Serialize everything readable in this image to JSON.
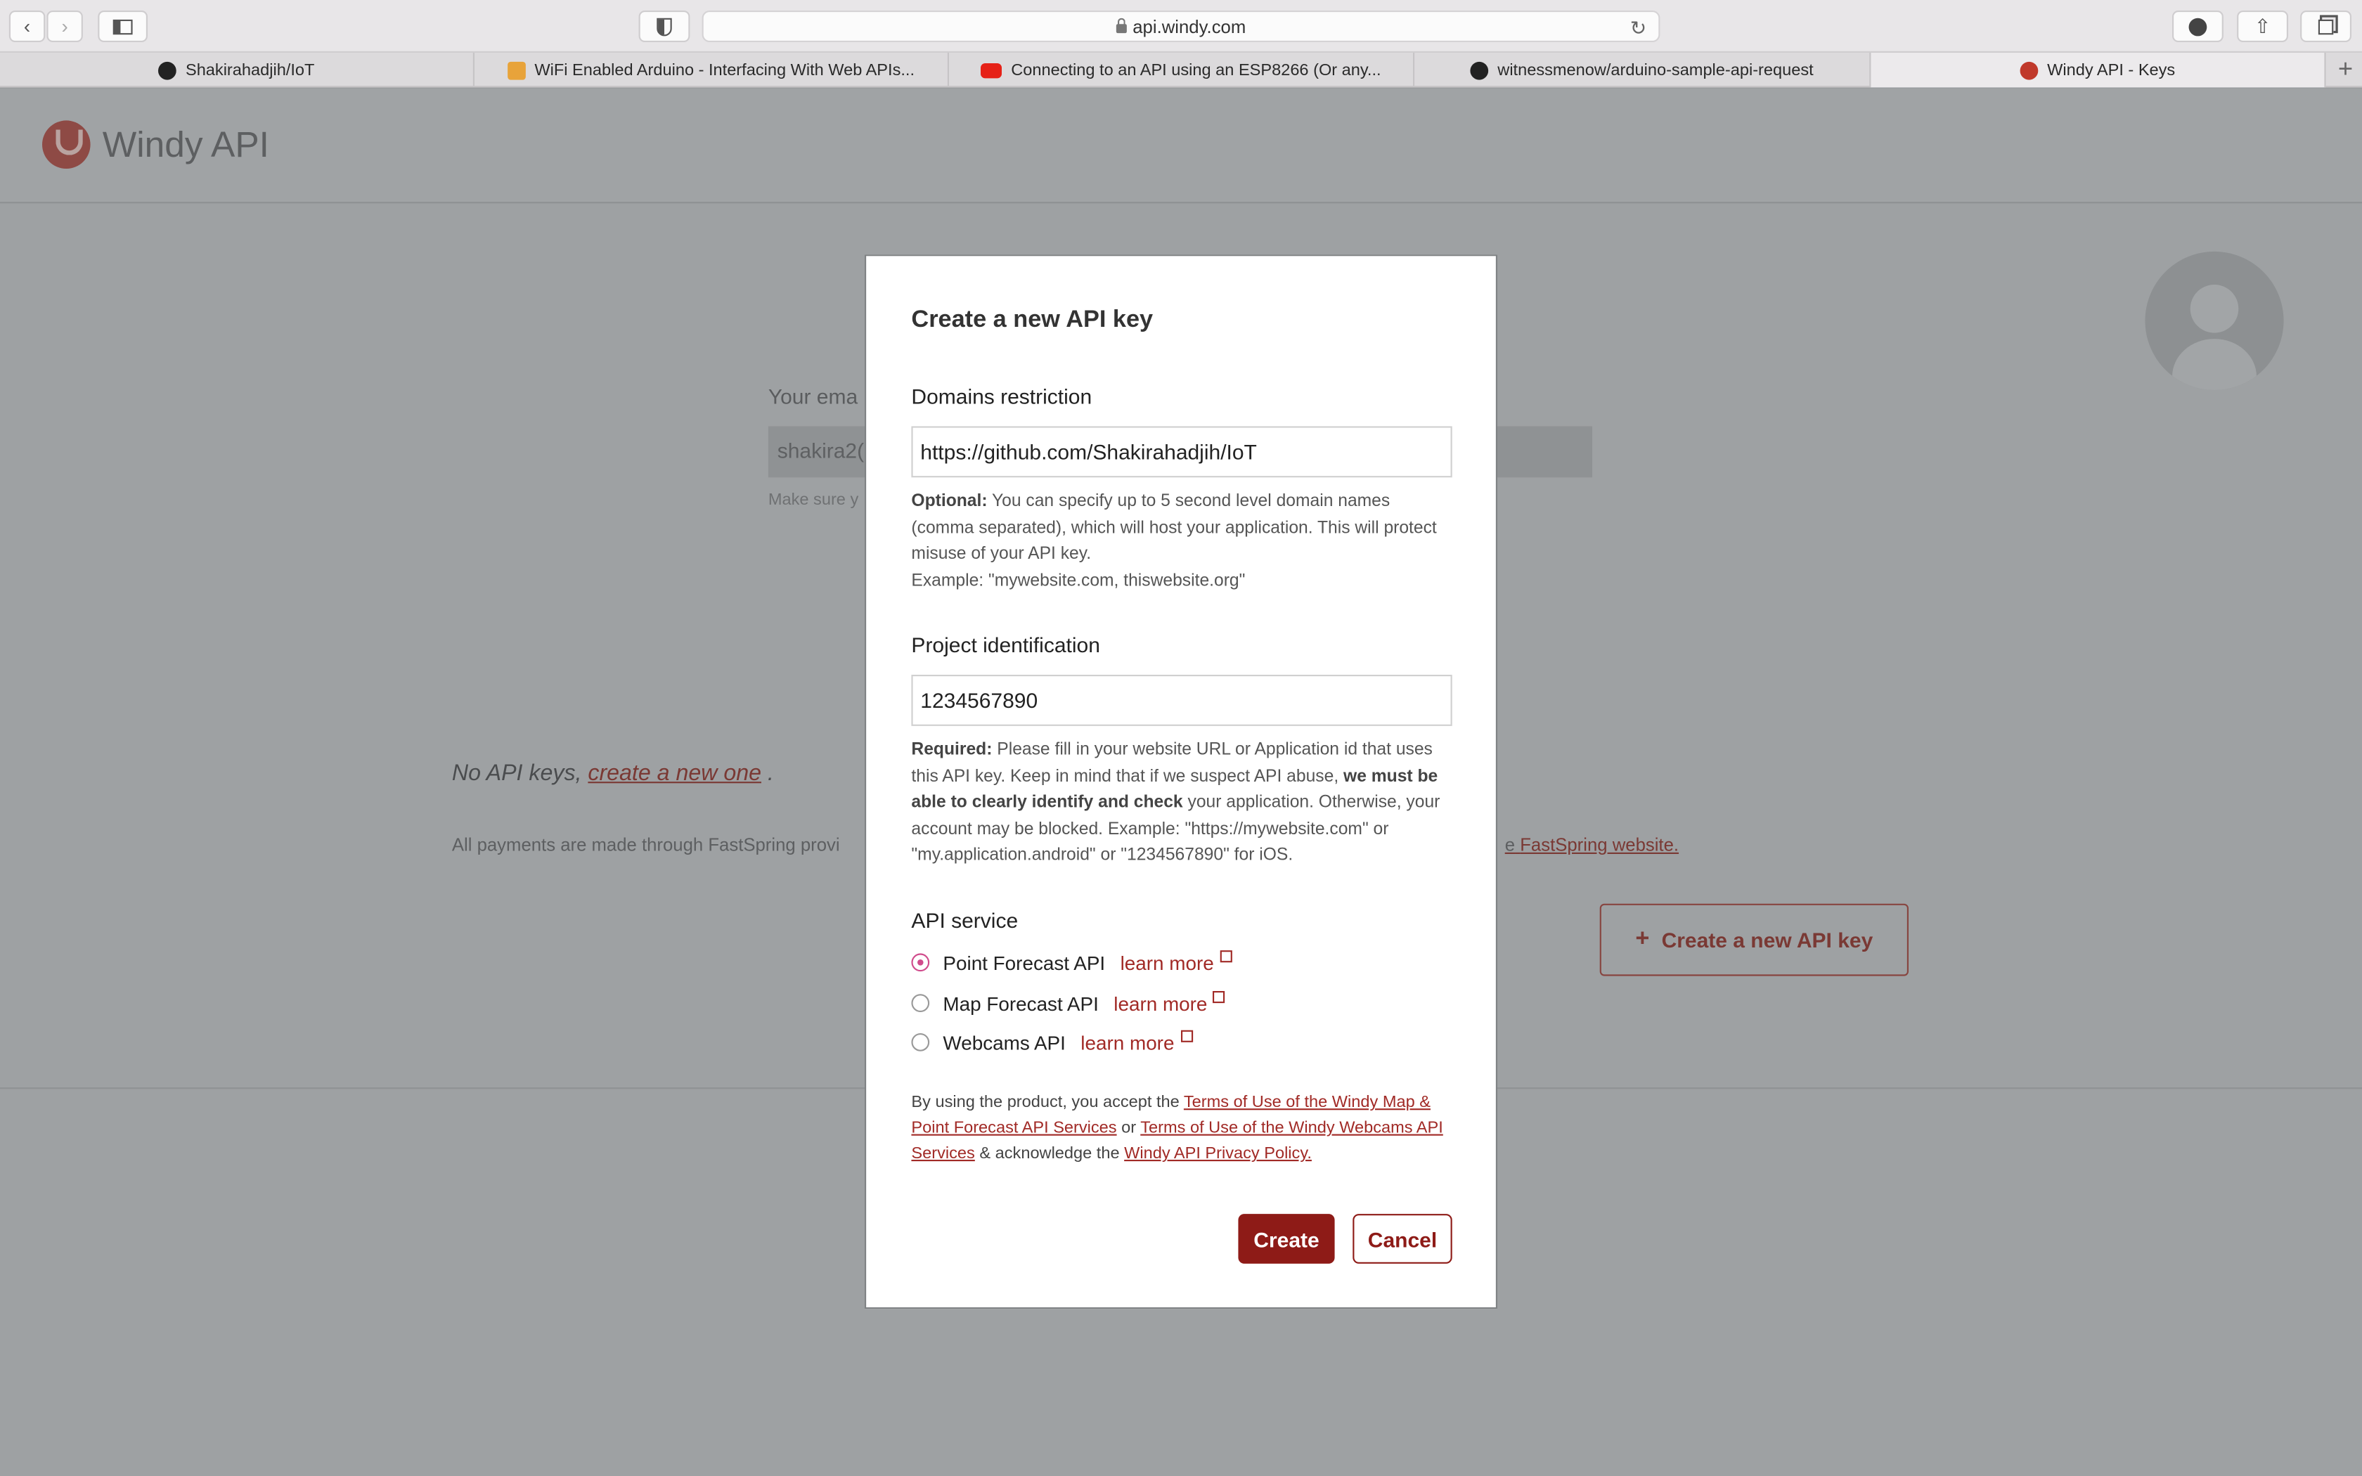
{
  "browser": {
    "url": "api.windy.com",
    "tabs": [
      {
        "title": "Shakirahadjih/IoT",
        "icon": "github-icon"
      },
      {
        "title": "WiFi Enabled Arduino - Interfacing With Web APIs...",
        "icon": "arduino-icon"
      },
      {
        "title": "Connecting to an API using an ESP8266 (Or any...",
        "icon": "youtube-icon"
      },
      {
        "title": "witnessmenow/arduino-sample-api-request",
        "icon": "github-icon"
      },
      {
        "title": "Windy API - Keys",
        "icon": "windy-icon"
      }
    ],
    "active_tab": 4
  },
  "page": {
    "logo_text": "Windy API",
    "email_label": "Your ema",
    "email_value": "shakira2(",
    "note": "Make sure y",
    "no_keys_text": "No API keys,",
    "create_link": "create a new one",
    "period": ".",
    "payments_text": "All payments are made through FastSpring provi",
    "fastspring_prefix": "e",
    "fastspring_link": "FastSpring website.",
    "create_key_button": "Create a new API key"
  },
  "modal": {
    "title": "Create a new API key",
    "domains": {
      "label": "Domains restriction",
      "value": "https://github.com/Shakirahadjih/IoT",
      "help_bold": "Optional:",
      "help_text": " You can specify up to 5 second level domain names (comma separated), which will host your application. This will protect misuse of your API key.",
      "example": "Example: \"mywebsite.com, thiswebsite.org\""
    },
    "project": {
      "label": "Project identification",
      "value": "1234567890",
      "help_bold": "Required:",
      "help_text_1": " Please fill in your website URL or Application id that uses this API key. Keep in mind that if we suspect API abuse, ",
      "help_bold_2": "we must be able to clearly identify and check",
      "help_text_2": " your application. Otherwise, your account may be blocked. Example: \"https://mywebsite.com\" or \"my.application.android\" or \"1234567890\" for iOS."
    },
    "service": {
      "label": "API service",
      "options": [
        {
          "label": "Point Forecast API",
          "link": "learn more",
          "checked": true
        },
        {
          "label": "Map Forecast API",
          "link": "learn more",
          "checked": false
        },
        {
          "label": "Webcams API",
          "link": "learn more",
          "checked": false
        }
      ]
    },
    "terms": {
      "t1": "By using the product, you accept the ",
      "link1": "Terms of Use of the Windy Map & Point Forecast API Services",
      "t2": " or ",
      "link2": "Terms of Use of the Windy Webcams API Services",
      "t3": " & acknowledge the ",
      "link3": "Windy API Privacy Policy."
    },
    "create_button": "Create",
    "cancel_button": "Cancel"
  },
  "colors": {
    "accent": "#8e1b17",
    "radio_checked": "#d04b8c",
    "overlay": "#9ea1a3"
  }
}
